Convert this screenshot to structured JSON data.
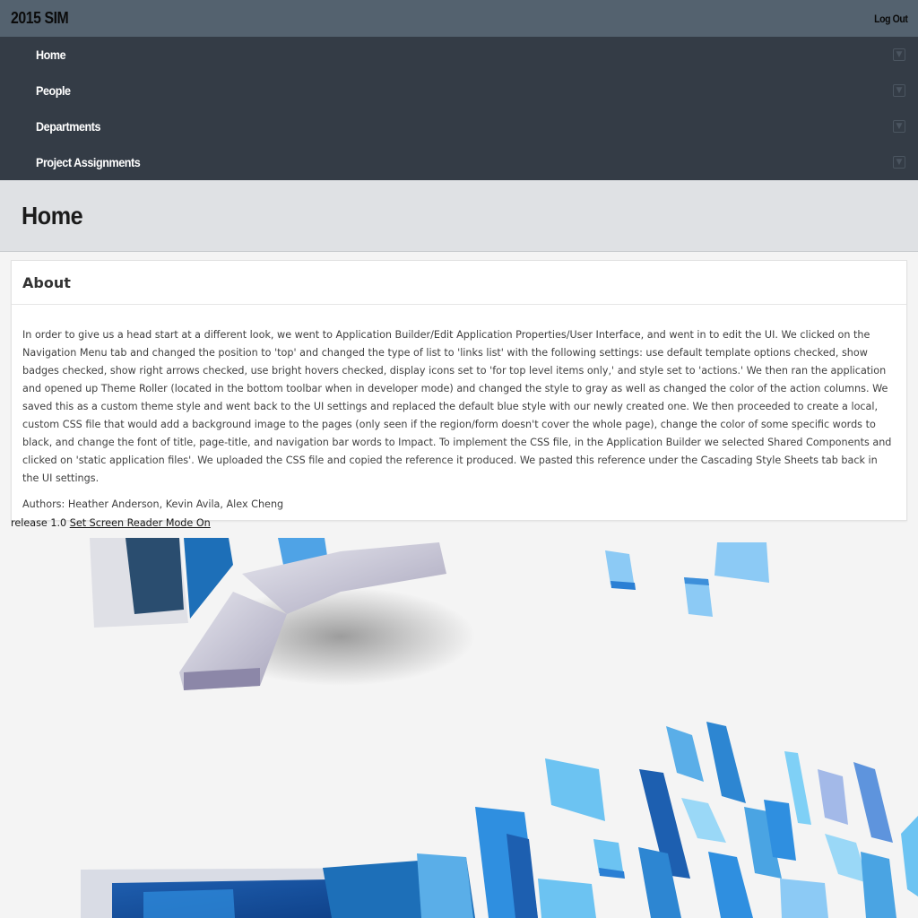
{
  "header": {
    "app_title": "2015 SIM",
    "logout_label": "Log Out"
  },
  "nav": {
    "items": [
      {
        "label": "Home"
      },
      {
        "label": "People"
      },
      {
        "label": "Departments"
      },
      {
        "label": "Project Assignments"
      }
    ]
  },
  "page": {
    "title": "Home"
  },
  "about": {
    "title": "About",
    "text": "In order to give us a head start at a different look, we went to Application Builder/Edit Application Properties/User Interface, and went in to edit the UI. We clicked on the Navigation Menu tab and changed the position to 'top' and changed the type of list to 'links list' with the following settings: use default template options checked, show badges checked, show right arrows checked, use bright hovers checked, display icons set to 'for top level items only,' and style set to 'actions.' We then ran the application and opened up Theme Roller (located in the bottom toolbar when in developer mode) and changed the style to gray as well as changed the color of the action columns. We saved this as a custom theme style and went back to the UI settings and replaced the default blue style with our newly created one. We then proceeded to create a local, custom CSS file that would add a background image to the pages (only seen if the region/form doesn't cover the whole page), change the color of some specific words to black, and change the font of title, page-title, and navigation bar words to Impact. To implement the CSS file, in the Application Builder we selected Shared Components and clicked on 'static application files'. We uploaded the CSS file and copied the reference it produced. We pasted this reference under the Cascading Style Sheets tab back in the UI settings.",
    "authors": "Authors: Heather Anderson, Kevin Avila, Alex Cheng"
  },
  "footer": {
    "release": "release 1.0",
    "screen_reader_link": "Set Screen Reader Mode On"
  },
  "colors": {
    "header_bg": "#54626f",
    "nav_bg": "#343c46",
    "title_band_bg": "#dfe1e4",
    "page_bg": "#f4f4f4",
    "accent_blue": "#2f8fe0"
  },
  "icons": {
    "nav_arrow": "chevron-down-icon"
  }
}
